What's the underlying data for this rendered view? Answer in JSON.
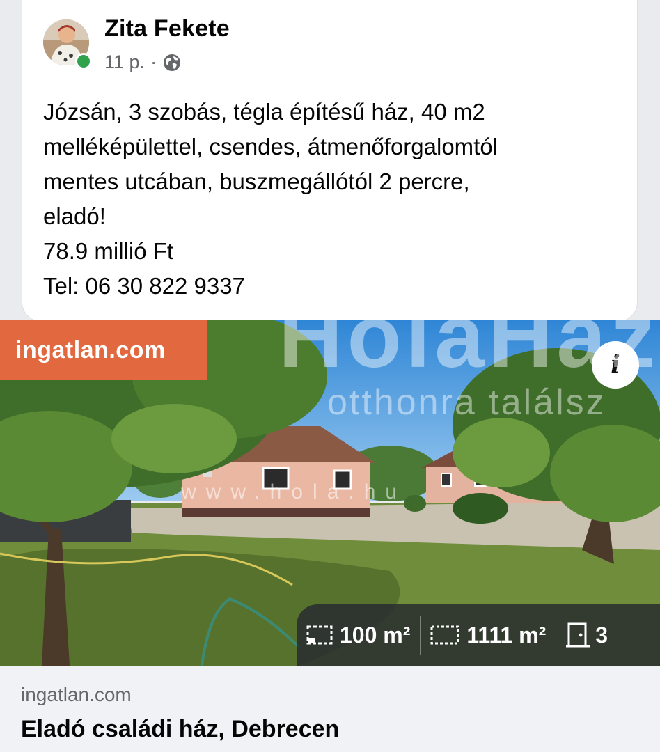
{
  "post": {
    "author": "Zita Fekete",
    "time": "11 p.",
    "separator": "·",
    "privacy_icon": "globe-icon",
    "text_lines": [
      "Józsán, 3 szobás, tégla építésű ház, 40 m2",
      "melléképülettel, csendes, átmenőforgalomtól",
      "mentes utcában, buszmegállótól 2 percre,",
      "eladó!",
      "78.9 millió Ft",
      "Tel: 06 30 822 9337"
    ]
  },
  "media": {
    "source_badge": "ingatlan.com",
    "info_label": "i",
    "watermark": {
      "brand": "HolaHáz",
      "tagline": "otthonra találsz",
      "url": "www.hola.hu"
    },
    "stats": [
      {
        "icon": "floor-area-icon",
        "label": "100 m²"
      },
      {
        "icon": "plot-area-icon",
        "label": "1111 m²"
      },
      {
        "icon": "door-icon",
        "label": "3"
      }
    ]
  },
  "link_preview": {
    "domain": "ingatlan.com",
    "title": "Eladó családi ház, Debrecen"
  },
  "colors": {
    "badge": "#e2683f",
    "online": "#31a24c",
    "meta_text": "#65676b",
    "footer_bg": "#f0f2f5"
  }
}
